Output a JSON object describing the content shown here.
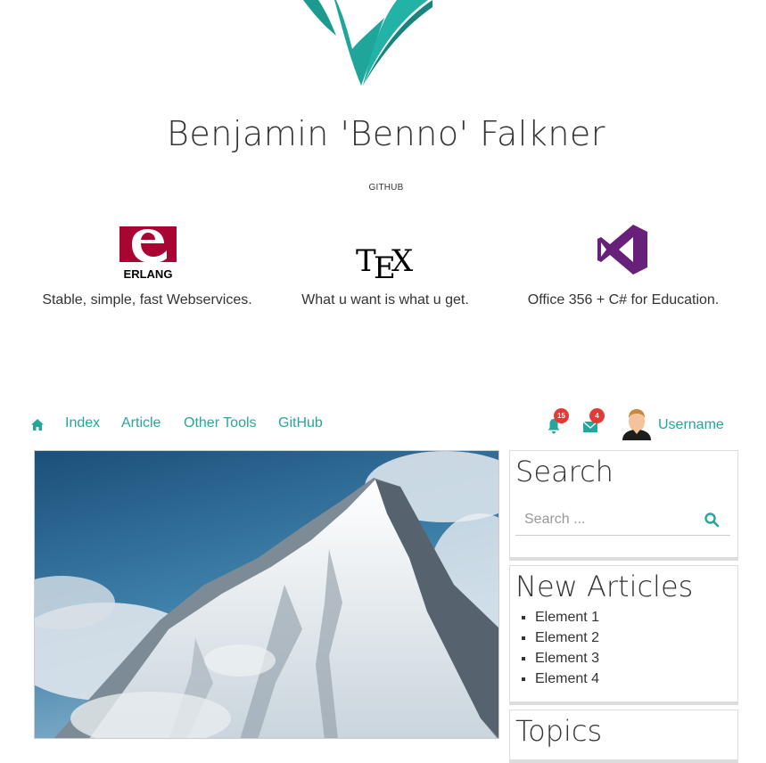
{
  "header": {
    "title": "Benjamin 'Benno' Falkner",
    "subtitle": "GITHUB"
  },
  "features": [
    {
      "icon": "erlang-logo",
      "logo_text": "ERLANG",
      "caption": "Stable, simple, fast Webservices."
    },
    {
      "icon": "tex-logo",
      "caption": "What u want is what u get."
    },
    {
      "icon": "visual-studio-logo",
      "caption": "Office 356 + C# for Education."
    }
  ],
  "nav": {
    "home_icon": "home-icon",
    "links": [
      "Index",
      "Article",
      "Other Tools",
      "GitHub"
    ],
    "notifications": {
      "icon": "bell-icon",
      "count": "15"
    },
    "messages": {
      "icon": "envelope-icon",
      "count": "4"
    },
    "username": "Username"
  },
  "sidebar": {
    "search": {
      "title": "Search",
      "placeholder": "Search ...",
      "icon": "search-icon"
    },
    "new_articles": {
      "title": "New Articles",
      "items": [
        "Element 1",
        "Element 2",
        "Element 3",
        "Element 4"
      ]
    },
    "topics": {
      "title": "Topics"
    }
  },
  "colors": {
    "accent": "#26a69a",
    "badge": "#e53935",
    "erlang": "#a90533",
    "visual_studio": "#68217a"
  }
}
